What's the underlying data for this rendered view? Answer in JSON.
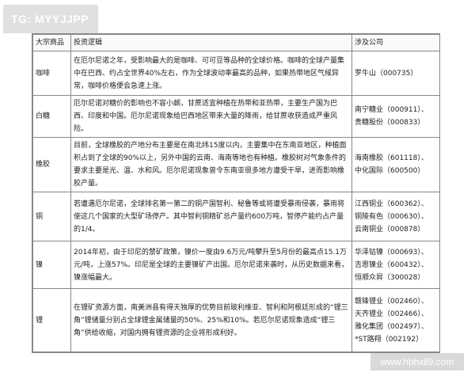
{
  "badge": {
    "label": "TG: MYYJJPP"
  },
  "table": {
    "headers": [
      "大宗商品",
      "投资逻辑",
      "涉及公司"
    ],
    "rows": [
      {
        "commodity": "咖啡",
        "logic": "在厄尔尼诺之年，受影响最大的是咖啡、可可豆等品种的全球价格。咖啡的全球产量集中在巴西、约占全世界40%左右，作为全球波动率最高的品种，如果热带地区气候异常，咖啡价格便会急速上涨。",
        "companies": [
          "罗牛山（000735）"
        ]
      },
      {
        "commodity": "白糖",
        "logic": "厄尔尼诺对糖价的影响也不容小觑，甘蔗适宜种植在热带和亚热带，主要生产国为巴西、印度和中国。厄尔尼诺现象给巴西地区带来大量的降雨，给甘蔗收获造成严重风险。",
        "companies": [
          "南宁糖业（000911）、",
          "贵糖股份（000833）"
        ]
      },
      {
        "commodity": "橡胶",
        "logic": "目前，全球橡胶的产地分布主要是在南北纬15度以内，主要集中在东南亚地区，种植面积占到了全球的90%以上，另外中国的云南、海南等地也有种植。橡胶树对气象条件的要求主要是光、温、水和风。厄尔尼诺现象曾令东南亚很多地方遭受干旱，进而影响橡胶产量。",
        "companies": [
          "海南橡胶（601118）、",
          "中化国际（600500）"
        ]
      },
      {
        "commodity": "铜",
        "logic": "若遭遇厄尔尼诺，全球排名第一第二的铜产国智利、秘鲁等或将遭受暴雨侵袭，暴雨将使这几个国家的大型矿场停产。其中智利铜精矿总产量约600万吨，智停产能约占产量的1/4。",
        "companies": [
          "江西铜业（600362）、",
          "铜陵有色（000630）、",
          "云南铜业（000878）"
        ]
      },
      {
        "commodity": "镍",
        "logic": "2014年初，由于印尼的禁矿政策，镍价一度由9.6万元/吨攀升至5月份的最高点15.1万元/吨，上涨57%。印尼是全球的主要镍矿产出国。厄尔尼诺来袭时，从历史数据来看，镍涨幅最大。",
        "companies": [
          "华泽钴镍（000693）、",
          "吉恩镍业（600432）、",
          "恒顺众昇（300028）"
        ]
      },
      {
        "commodity": "锂",
        "logic": "在锂矿资源方面，南美洲县有得天独厚的优势目前玻利维亚、智利和阿根廷形成的“锂三角”锂储量分别占全球锂金属储量的50%、25%和10%。若厄尔尼诺现象造成“锂三角”供给收缩，对国内拥有锂资源的企业将形成利好。",
        "companies": [
          "赣锋锂业（002460）、",
          "天齐锂业（002466）、",
          "雅化集团（002497）、",
          "*ST路翔（002192）"
        ]
      }
    ]
  },
  "watermark": {
    "text": "www.hbhxll9.com"
  }
}
